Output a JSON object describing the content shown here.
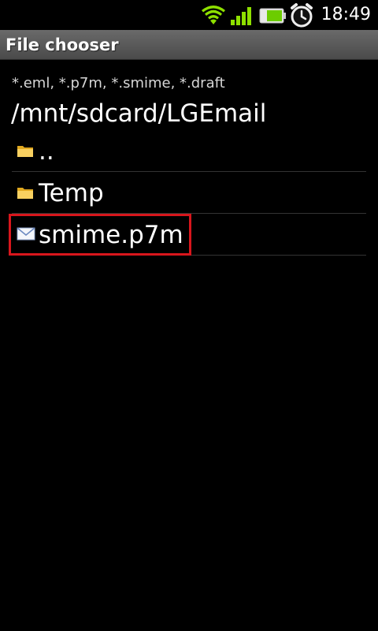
{
  "status_bar": {
    "time": "18:49",
    "icons": [
      "wifi-icon",
      "signal-icon",
      "battery-icon",
      "alarm-clock-icon"
    ]
  },
  "title_bar": {
    "title": "File chooser"
  },
  "chooser": {
    "filter": "*.eml, *.p7m, *.smime, *.draft",
    "path": "/mnt/sdcard/LGEmail",
    "items": [
      {
        "label": "..",
        "icon": "folder-icon"
      },
      {
        "label": "Temp",
        "icon": "folder-icon"
      },
      {
        "label": "smime.p7m",
        "icon": "email-envelope-icon"
      }
    ]
  },
  "colors": {
    "highlight": "#d8161c",
    "title_bar": "#5a5a5a",
    "folder": "#f0c040"
  }
}
